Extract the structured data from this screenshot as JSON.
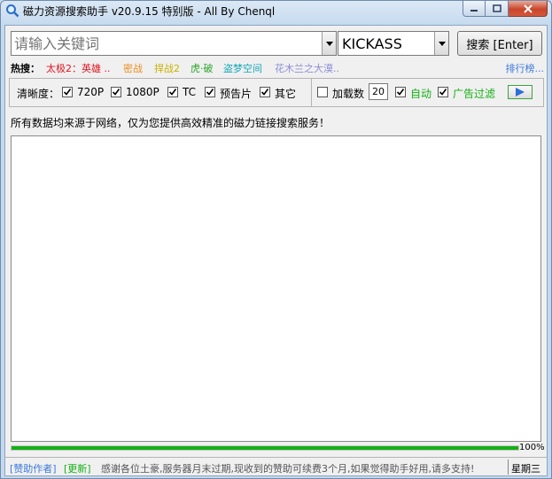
{
  "window": {
    "title": "磁力资源搜索助手 v20.9.15 特别版 - All By Chenql"
  },
  "search": {
    "keyword_placeholder": "请输入关键词",
    "site_selected": "KICKASS",
    "search_button": "搜索 [Enter]"
  },
  "hot": {
    "label": "热搜：",
    "items": [
      {
        "text": "太极2：英雄 ..",
        "color": "#e0141e"
      },
      {
        "text": "密战",
        "color": "#f08c1e"
      },
      {
        "text": "捍战2",
        "color": "#c8b400"
      },
      {
        "text": "虎·破",
        "color": "#2aa52a"
      },
      {
        "text": "盗梦空间",
        "color": "#18a8b8"
      },
      {
        "text": "花木兰之大漠..",
        "color": "#8c8cd8"
      }
    ],
    "rank_link": "排行榜..."
  },
  "options": {
    "clarity_label": "清晰度：",
    "clarity": [
      {
        "label": "720P",
        "checked": true
      },
      {
        "label": "1080P",
        "checked": true
      },
      {
        "label": "TC",
        "checked": true
      },
      {
        "label": "预告片",
        "checked": true
      },
      {
        "label": "其它",
        "checked": true
      }
    ],
    "load_count_label": "加载数",
    "load_count_checked": false,
    "load_count_value": "20",
    "auto_label": "自动",
    "auto_checked": true,
    "ad_filter_label": "广告过滤",
    "ad_filter_checked": true
  },
  "notice": "所有数据均来源于网络，仅为您提供高效精准的磁力链接搜索服务！",
  "progress": {
    "value": 1.0,
    "text": "100%"
  },
  "status": {
    "sponsor": "[赞助作者]",
    "update": "[更新]",
    "message": "感谢各位土豪,服务器月末过期,现收到的赞助可续费3个月,如果觉得助手好用,请多支持!",
    "weekday": "星期三"
  },
  "colors": {
    "link_blue": "#3b7ad9",
    "green": "#15b015",
    "status_gray": "#555555"
  }
}
